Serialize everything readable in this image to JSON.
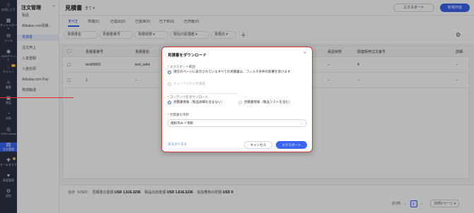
{
  "rail": {
    "items": [
      {
        "icon": "star-icon",
        "label": "お気に入り"
      },
      {
        "icon": "dashboard-icon",
        "label": "ダッシュボード"
      },
      {
        "icon": "mail-icon",
        "label": "メール"
      },
      {
        "icon": "sns-icon",
        "label": "SNSチャット"
      },
      {
        "icon": "chat-icon",
        "label": "チャット",
        "badge": "57"
      },
      {
        "icon": "customer-icon",
        "label": "顧客"
      },
      {
        "icon": "mall-icon",
        "label": "商品"
      },
      {
        "icon": "analysis-icon",
        "label": "分析"
      },
      {
        "icon": "okki-icon",
        "label": "OKKI Leads"
      },
      {
        "icon": "order-icon",
        "label": "注文管理"
      },
      {
        "icon": "team-icon",
        "label": "チームタスク",
        "badge": "6"
      },
      {
        "icon": "marketing-icon",
        "label": "承認管理"
      },
      {
        "icon": "settings-icon",
        "label": "設定"
      }
    ]
  },
  "sidebar": {
    "title": "注文管理",
    "collapse": "«",
    "items": [
      {
        "label": "製品"
      },
      {
        "label": "Alibaba.com見積..."
      },
      {
        "label": "見積書"
      },
      {
        "label": "注文売上"
      },
      {
        "label": "入金登録"
      },
      {
        "label": "入金伝票"
      },
      {
        "label": "Alibaba.com Pay"
      },
      {
        "label": "物流輸送"
      }
    ]
  },
  "header": {
    "title": "見積書",
    "filter": "全て ▾",
    "export": "エクスポート",
    "new": "新規作成"
  },
  "tabs": [
    {
      "label": "すべて"
    },
    {
      "label": "草稿(2)"
    },
    {
      "label": "已提出(0)"
    },
    {
      "label": "已批准(0)"
    },
    {
      "label": "已下单(0)"
    },
    {
      "label": "已作废(0)"
    }
  ],
  "filters": [
    {
      "label": "見積書名"
    },
    {
      "label": "見積書番号"
    },
    {
      "label": "見積状態 ▾"
    },
    {
      "label": "現在の処理者 ▾"
    },
    {
      "label": "見積日 ▾"
    }
  ],
  "table": {
    "columns": [
      "見積書番号",
      "見積書名",
      "承認状態",
      "関連販売注文番号",
      "詳細"
    ],
    "rows": [
      {
        "no": "test00001",
        "name": "test_sokk",
        "status": "--",
        "related": "4",
        "detail": "--"
      },
      {
        "no": "1",
        "name": "--",
        "status": "--",
        "related": "--",
        "detail": "--"
      }
    ]
  },
  "footer": {
    "sum_prefix": "合計（USD）：",
    "sum1_label": "見積書の金額",
    "sum1_value": "USD 1,616.3236",
    "sum2_label": "製品の総金額",
    "sum2_value": "USD 1,616.3236",
    "sum3_label": "追加費用の総額",
    "sum3_value": "USD 0",
    "total": "計2件",
    "page": "1",
    "page_size": "20件/ページ ▾"
  },
  "modal": {
    "title": "見積書をダウンロード",
    "close": "×",
    "scope_label": "エクスポート範囲",
    "scope_opt1": "現在のページに表示されているすべての見積書は、フィルタ条件の影響を受けます",
    "scope_opt2": "チェックされた見積書",
    "content_label": "コンテンツをダウンロード",
    "content_opt1": "見積書情報（製品詳細を含まない）",
    "content_opt2": "見積書情報（製品リストを含む）",
    "items_label": "見積書の項目",
    "items_value": "選択済み 7 項目",
    "tasklist": "タスクリスト",
    "cancel": "キャンセル",
    "export": "エクスポート"
  }
}
